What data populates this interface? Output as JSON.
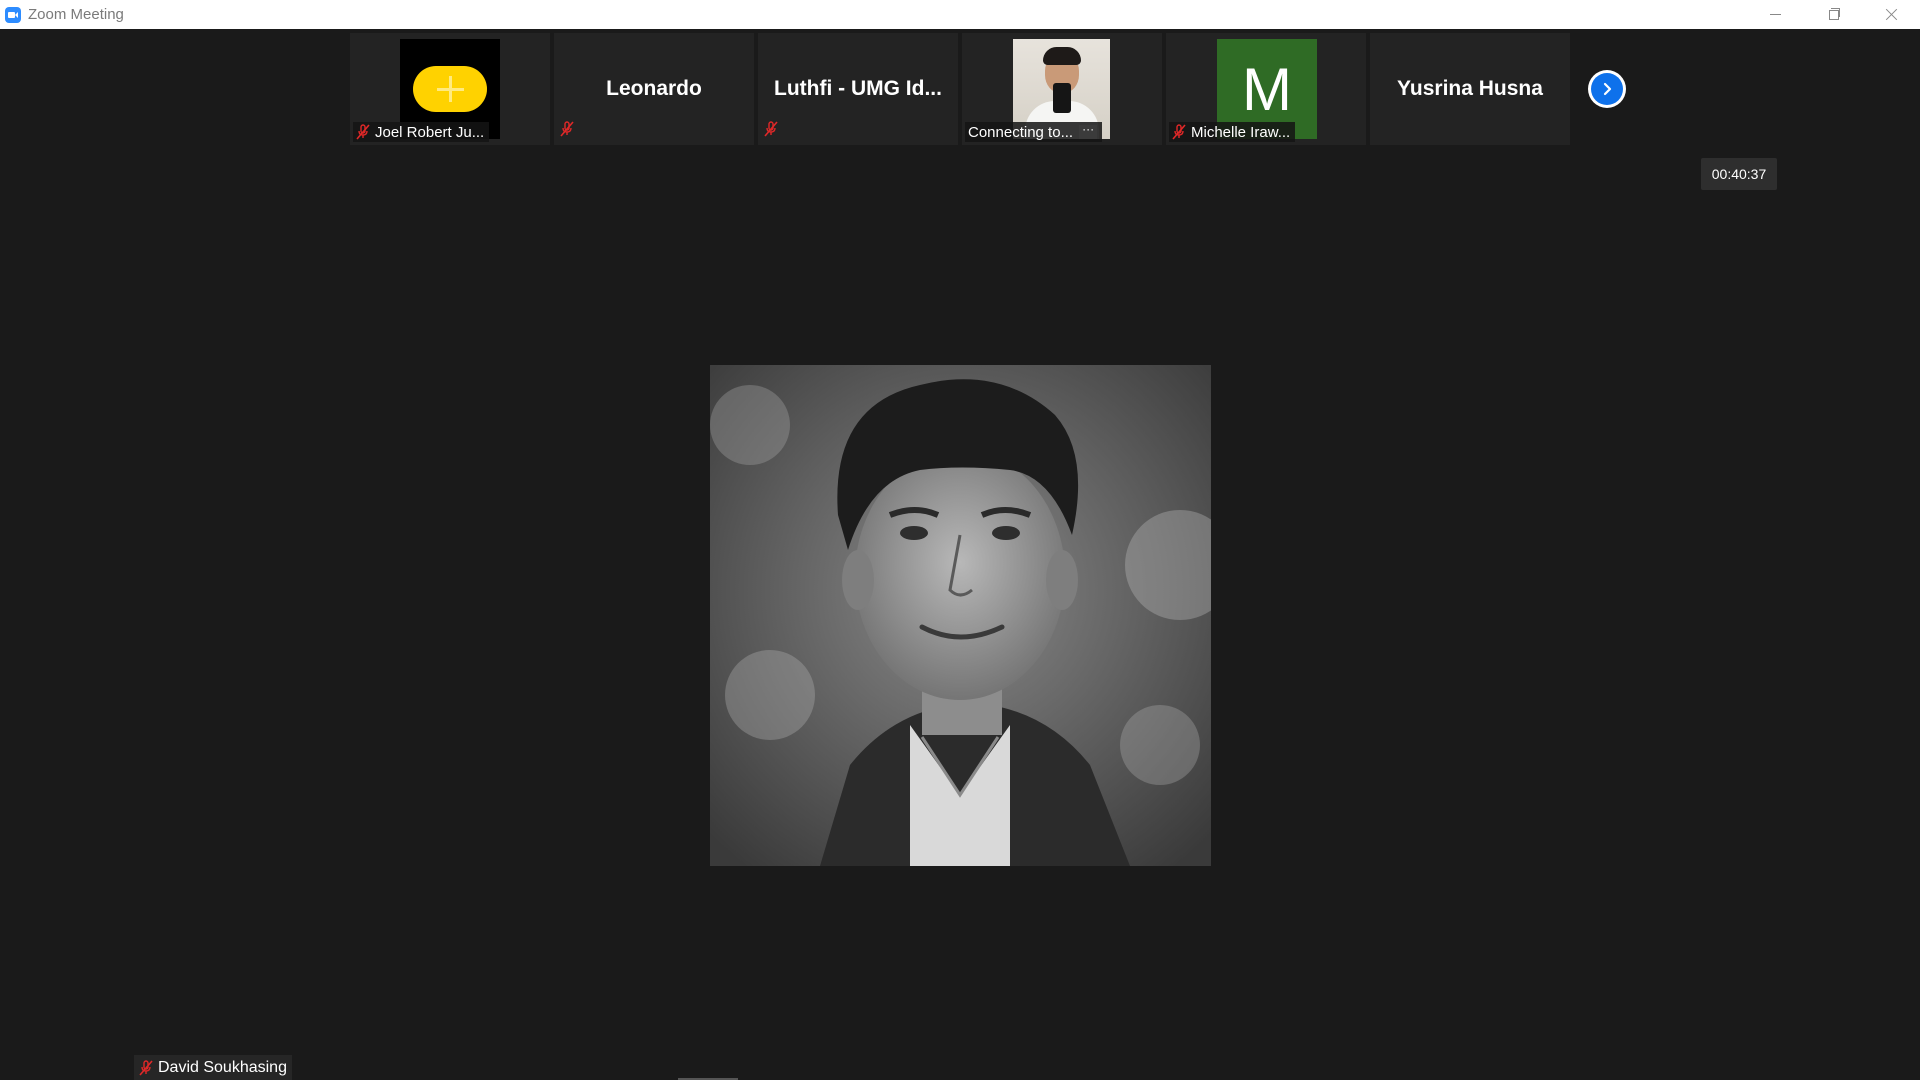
{
  "window": {
    "title": "Zoom Meeting"
  },
  "gallery": {
    "tiles": [
      {
        "name": "Joel Robert Ju...",
        "muted": true,
        "avatar": "yellow-graphic"
      },
      {
        "name": "Leonardo",
        "muted": true,
        "avatar": "name-only"
      },
      {
        "name": "Luthfi - UMG Id...",
        "muted": true,
        "avatar": "name-only"
      },
      {
        "name": "Connecting to...",
        "muted": false,
        "avatar": "photo"
      },
      {
        "name": "Michelle Iraw...",
        "muted": true,
        "avatar": "initial",
        "initial": "M"
      },
      {
        "name": "Yusrina Husna",
        "muted": false,
        "avatar": "name-only"
      }
    ],
    "more_icon": "ellipsis-icon",
    "next_icon": "chevron-right-icon"
  },
  "meeting": {
    "elapsed": "00:40:37"
  },
  "active_speaker": {
    "name": "David Soukhasing",
    "muted": true
  },
  "colors": {
    "background": "#1a1a1a",
    "tile": "#232323",
    "accent": "#0e71eb",
    "muted_red": "#e02828",
    "initial_avatar": "#2f6b25",
    "yellow_avatar": "#ffd200"
  }
}
